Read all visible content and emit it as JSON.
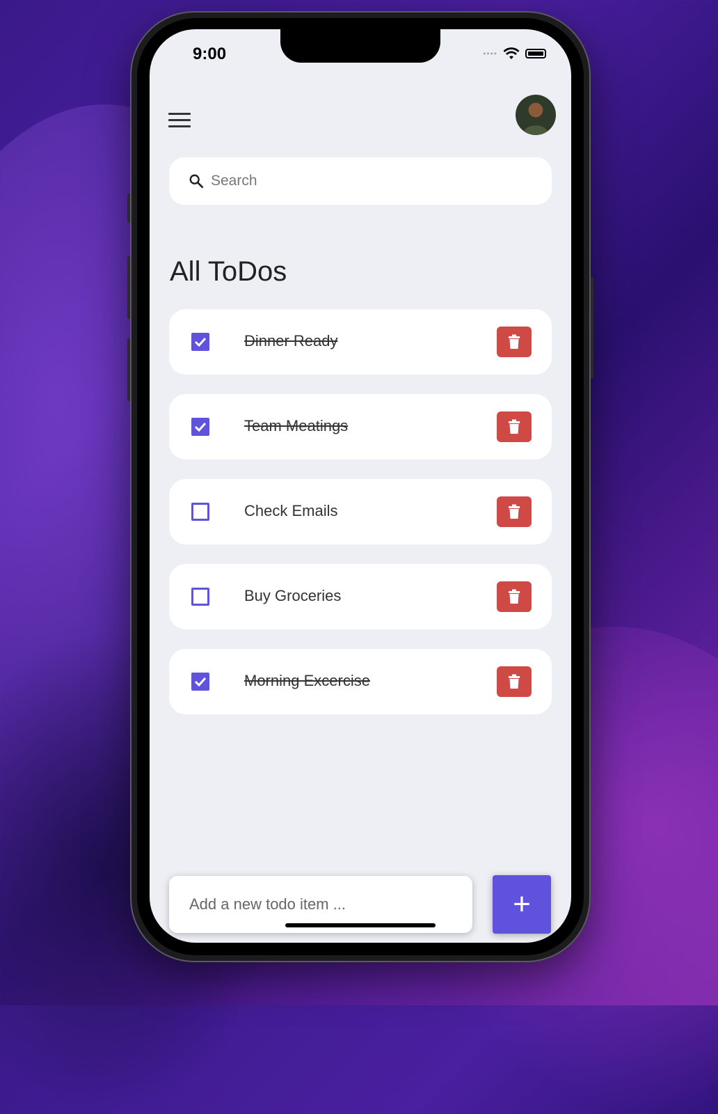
{
  "status_bar": {
    "time": "9:00"
  },
  "search": {
    "placeholder": "Search",
    "icon": "search-icon"
  },
  "page_title": "All ToDos",
  "todos": [
    {
      "label": "Dinner Ready",
      "done": true
    },
    {
      "label": "Team Meatings",
      "done": true
    },
    {
      "label": "Check Emails",
      "done": false
    },
    {
      "label": "Buy Groceries",
      "done": false
    },
    {
      "label": "Morning Excercise",
      "done": true
    }
  ],
  "add_todo": {
    "placeholder": "Add a new todo item ...",
    "button_label": "+"
  },
  "colors": {
    "accent": "#5f52dc",
    "delete": "#d04a45",
    "background": "#eeeff5"
  }
}
